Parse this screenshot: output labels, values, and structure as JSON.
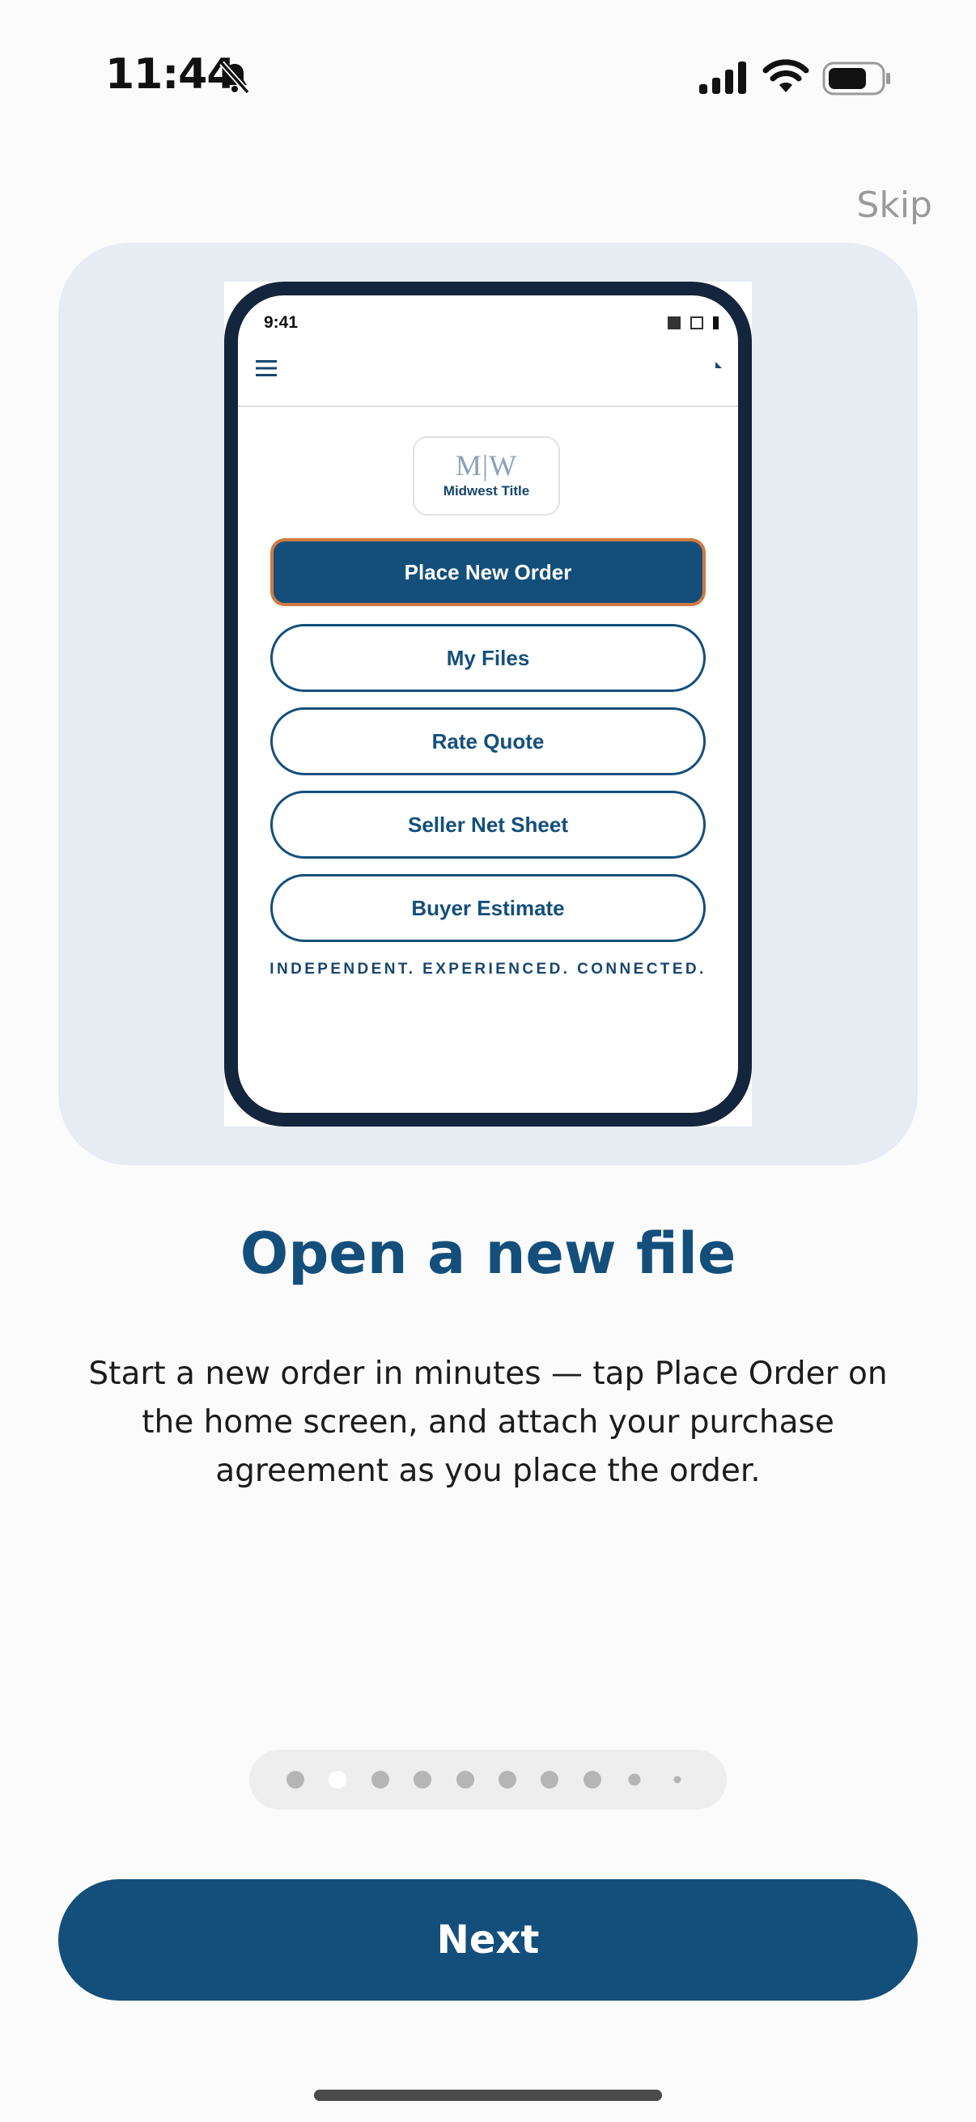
{
  "status_bar": {
    "time": "11:44",
    "icons": [
      "bell-slash-icon",
      "cellular-signal-icon",
      "wifi-icon",
      "battery-icon"
    ]
  },
  "skip_label": "Skip",
  "illustration": {
    "mock_time": "9:41",
    "logo_mark": "M|W",
    "logo_text": "Midwest Title",
    "buttons": [
      "Place New Order",
      "My Files",
      "Rate Quote",
      "Seller Net Sheet",
      "Buyer Estimate"
    ],
    "tagline": "INDEPENDENT. EXPERIENCED. CONNECTED.",
    "highlight_color": "#d27a3e"
  },
  "title": "Open a new file",
  "description": "Start a new order in minutes — tap Place Order on the home screen, and attach your purchase agreement as you place the order.",
  "page_indicator": {
    "total": 10,
    "current_index": 1
  },
  "next_label": "Next",
  "colors": {
    "brand": "#144f7c",
    "card_background": "#e7ecf3",
    "skip_text": "#9a9a9a"
  }
}
